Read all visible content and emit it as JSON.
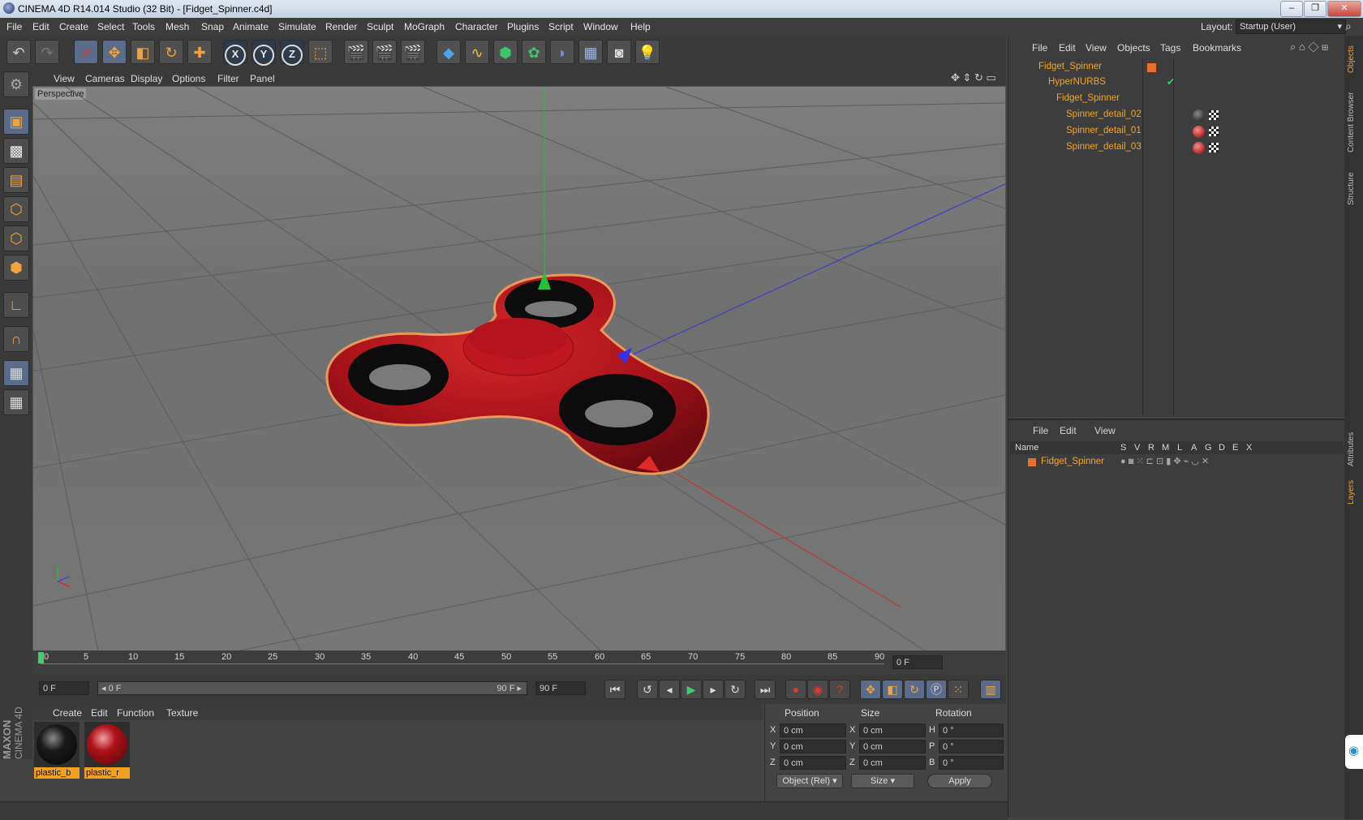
{
  "window": {
    "title": "CINEMA 4D R14.014 Studio (32 Bit) - [Fidget_Spinner.c4d]",
    "minimize": "–",
    "restore": "❐",
    "close": "✕"
  },
  "menu": [
    "File",
    "Edit",
    "Create",
    "Select",
    "Tools",
    "Mesh",
    "Snap",
    "Animate",
    "Simulate",
    "Render",
    "Sculpt",
    "MoGraph",
    "Character",
    "Plugins",
    "Script",
    "Window",
    "Help"
  ],
  "layout": {
    "label": "Layout:",
    "value": "Startup (User)"
  },
  "viewport": {
    "menu": [
      "View",
      "Cameras",
      "Display",
      "Options",
      "Filter",
      "Panel"
    ],
    "label": "Perspective"
  },
  "toolbar": {
    "x": "X",
    "y": "Y",
    "z": "Z"
  },
  "timeline": {
    "ticks": [
      "0",
      "5",
      "10",
      "15",
      "20",
      "25",
      "30",
      "35",
      "40",
      "45",
      "50",
      "55",
      "60",
      "65",
      "70",
      "75",
      "80",
      "85",
      "90"
    ],
    "current_frame": "0 F",
    "start_field": "0 F",
    "range_left": "◂ 0 F",
    "range_right": "90 F ▸",
    "end_field": "90 F"
  },
  "materials": {
    "menu": [
      "Create",
      "Edit",
      "Function",
      "Texture"
    ],
    "items": [
      {
        "name": "plastic_b",
        "color": "#1a1a1a"
      },
      {
        "name": "plastic_r",
        "color": "#b0121a"
      }
    ]
  },
  "coords": {
    "headers": [
      "Position",
      "Size",
      "Rotation"
    ],
    "rows": [
      {
        "pl": "X",
        "pv": "0 cm",
        "sl": "X",
        "sv": "0 cm",
        "rl": "H",
        "rv": "0 °"
      },
      {
        "pl": "Y",
        "pv": "0 cm",
        "sl": "Y",
        "sv": "0 cm",
        "rl": "P",
        "rv": "0 °"
      },
      {
        "pl": "Z",
        "pv": "0 cm",
        "sl": "Z",
        "sv": "0 cm",
        "rl": "B",
        "rv": "0 °"
      }
    ],
    "mode": "Object (Rel)",
    "size_mode": "Size",
    "apply": "Apply"
  },
  "objects": {
    "menu": [
      "File",
      "Edit",
      "View",
      "Objects",
      "Tags",
      "Bookmarks"
    ],
    "tree": [
      "Fidget_Spinner",
      "HyperNURBS",
      "Fidget_Spinner",
      "Spinner_detail_02",
      "Spinner_detail_01",
      "Spinner_detail_03"
    ]
  },
  "layers": {
    "menu": [
      "File",
      "Edit",
      "View"
    ],
    "columns": [
      "Name",
      "S",
      "V",
      "R",
      "M",
      "L",
      "A",
      "G",
      "D",
      "E",
      "X"
    ],
    "row": "Fidget_Spinner"
  },
  "sidetabs": [
    "Objects",
    "Content Browser",
    "Structure",
    "Attributes",
    "Layers"
  ],
  "brand": {
    "line1": "MAXON",
    "line2": "CINEMA 4D"
  },
  "colors": {
    "accent": "#f5a623",
    "spinner": "#b3141a"
  }
}
